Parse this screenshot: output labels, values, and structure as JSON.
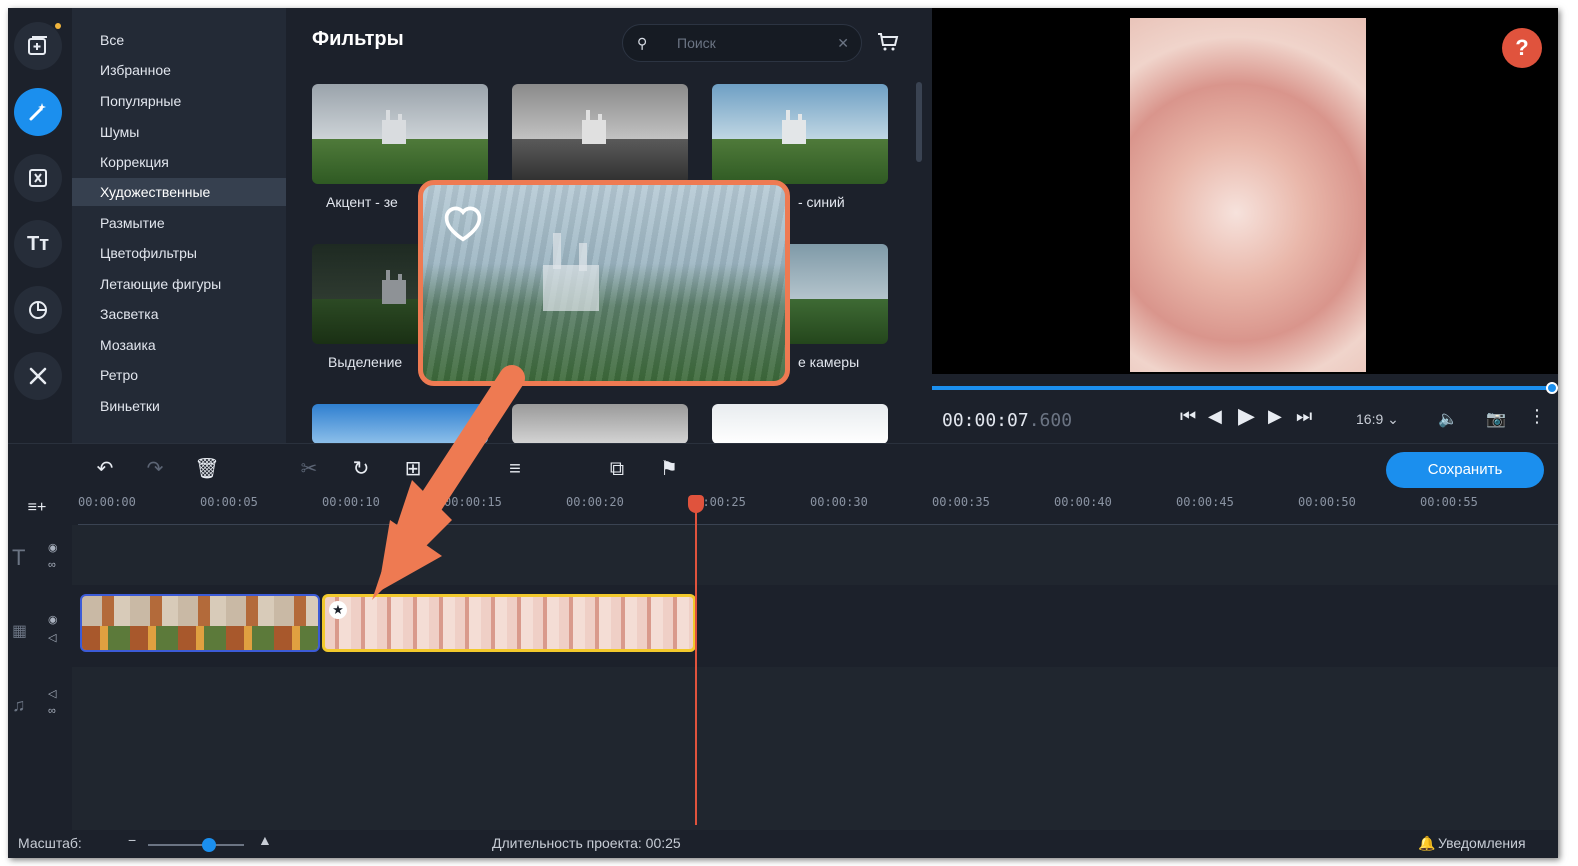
{
  "categories": [
    "Все",
    "Избранное",
    "Популярные",
    "Шумы",
    "Коррекция",
    "Художественные",
    "Размытие",
    "Цветофильтры",
    "Летающие фигуры",
    "Засветка",
    "Мозаика",
    "Ретро",
    "Виньетки"
  ],
  "active_category": "Художественные",
  "filters": {
    "title": "Фильтры",
    "search_placeholder": "Поиск",
    "thumb_labels": {
      "t1": "Акцент - зе",
      "t3": "- синий",
      "t4": "Выделение",
      "t6": "е камеры"
    }
  },
  "preview": {
    "help_label": "?",
    "timecode_main": "00:00:07",
    "timecode_ms": ".600",
    "aspect_ratio": "16:9",
    "progress_fraction": 0.99
  },
  "toolbar": {
    "save_label": "Сохранить"
  },
  "timeline": {
    "ticks": [
      "00:00:00",
      "00:00:05",
      "00:00:10",
      "00:00:15",
      "00:00:20",
      "00:00:25",
      "00:00:30",
      "00:00:35",
      "00:00:40",
      "00:00:45",
      "00:00:50",
      "00:00:55"
    ]
  },
  "status": {
    "zoom_label": "Масштаб:",
    "duration_label": "Длительность проекта: 00:25",
    "notifications_label": "Уведомления"
  },
  "colors": {
    "accent": "#1b8fee",
    "highlight": "#ee7a52",
    "playhead": "#e0533d",
    "selected_clip": "#f2c92c"
  }
}
